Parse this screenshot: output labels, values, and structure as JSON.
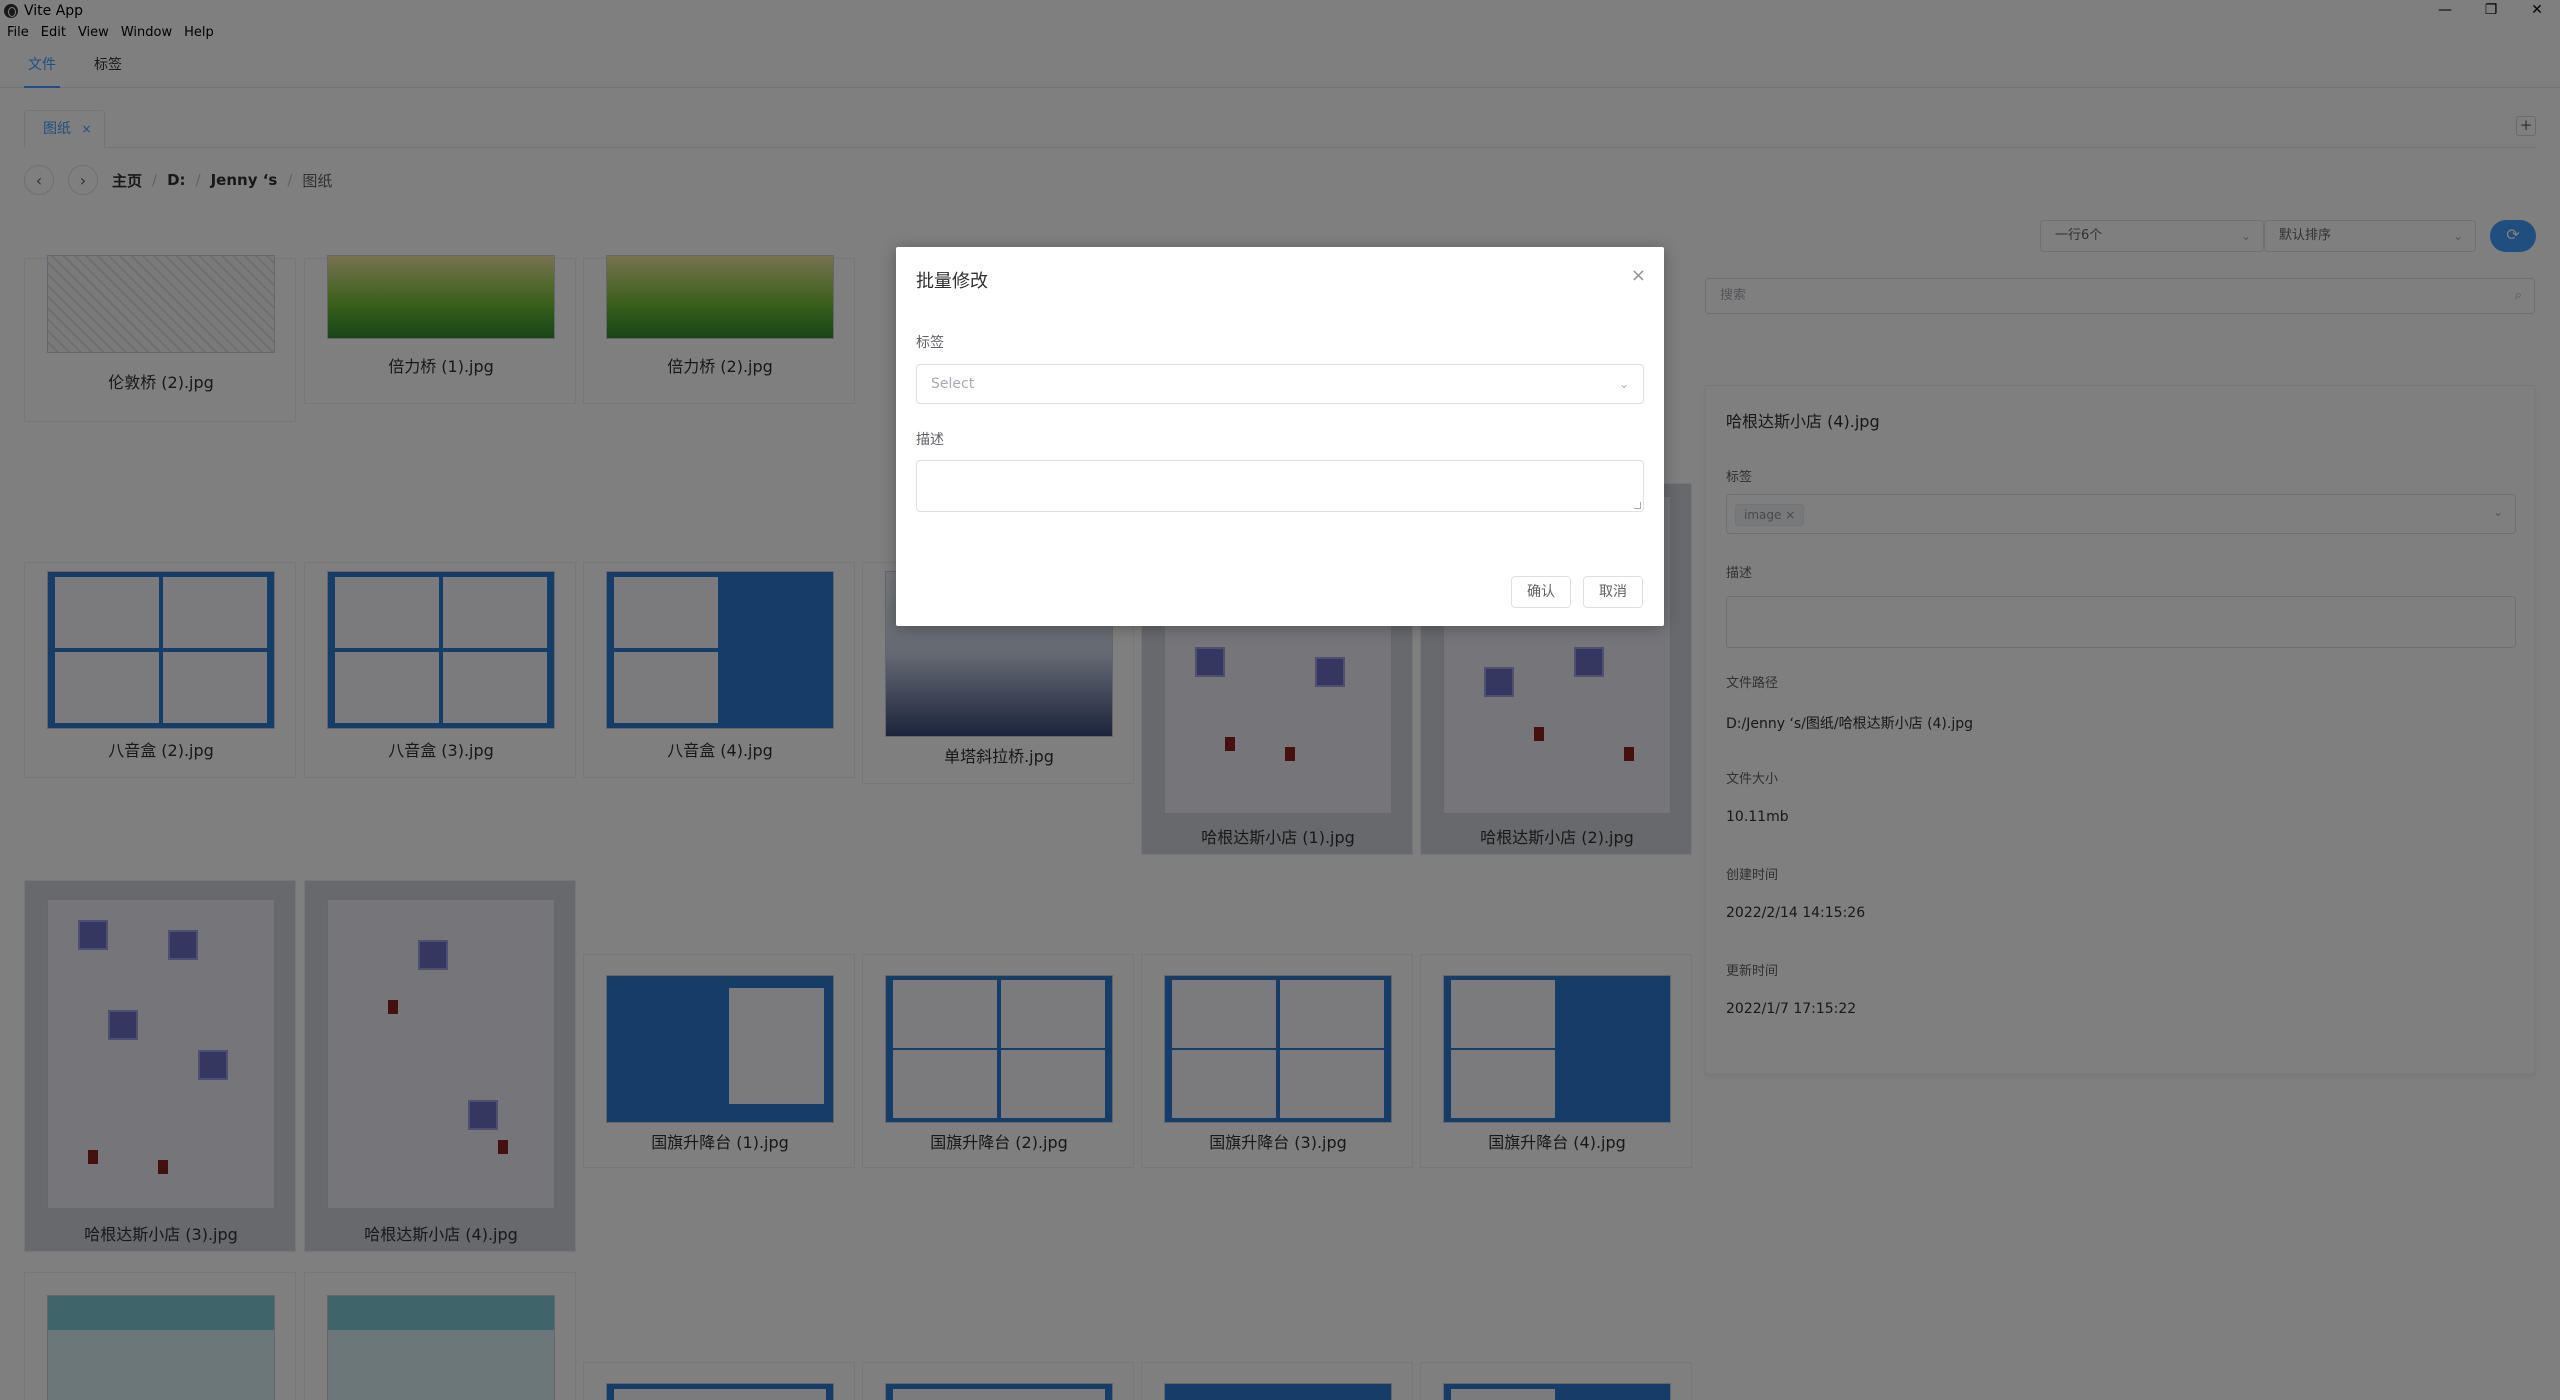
{
  "window": {
    "title": "Vite App",
    "controls": [
      "—",
      "❐",
      "✕"
    ]
  },
  "menu": [
    "File",
    "Edit",
    "View",
    "Window",
    "Help"
  ],
  "tabs": [
    {
      "label": "文件",
      "active": true
    },
    {
      "label": "标签",
      "active": false
    }
  ],
  "subtab": {
    "label": "图纸",
    "close": "×",
    "add": "+"
  },
  "breadcrumb": {
    "back": "‹",
    "forward": "›",
    "items": [
      "主页",
      "D:",
      "Jenny ‘s",
      "图纸"
    ],
    "separator": "/"
  },
  "toolbar": {
    "layout_value": "一行6个",
    "sort_value": "默认排序",
    "refresh_icon": "⟳"
  },
  "files": [
    "伦敦桥 (2).jpg",
    "倍力桥 (1).jpg",
    "倍力桥 (2).jpg",
    "八音盒 (2).jpg",
    "八音盒 (3).jpg",
    "八音盒 (4).jpg",
    "单塔斜拉桥.jpg",
    "哈根达斯小店 (1).jpg",
    "哈根达斯小店 (2).jpg",
    "哈根达斯小店 (3).jpg",
    "哈根达斯小店 (4).jpg",
    "国旗升降台 (1).jpg",
    "国旗升降台 (2).jpg",
    "国旗升降台 (3).jpg",
    "国旗升降台 (4).jpg"
  ],
  "search": {
    "placeholder": "搜索"
  },
  "detail": {
    "title": "哈根达斯小店 (4).jpg",
    "tags_label": "标签",
    "tag": "image",
    "tag_close": "×",
    "desc_label": "描述",
    "path_label": "文件路径",
    "path": "D:/Jenny ‘s/图纸/哈根达斯小店 (4).jpg",
    "size_label": "文件大小",
    "size": "10.11mb",
    "created_label": "创建时间",
    "created": "2022/2/14 14:15:26",
    "updated_label": "更新时间",
    "updated": "2022/1/7 17:15:22"
  },
  "dialog": {
    "title": "批量修改",
    "close": "×",
    "tags_label": "标签",
    "tags_placeholder": "Select",
    "desc_label": "描述",
    "confirm": "确认",
    "cancel": "取消"
  }
}
